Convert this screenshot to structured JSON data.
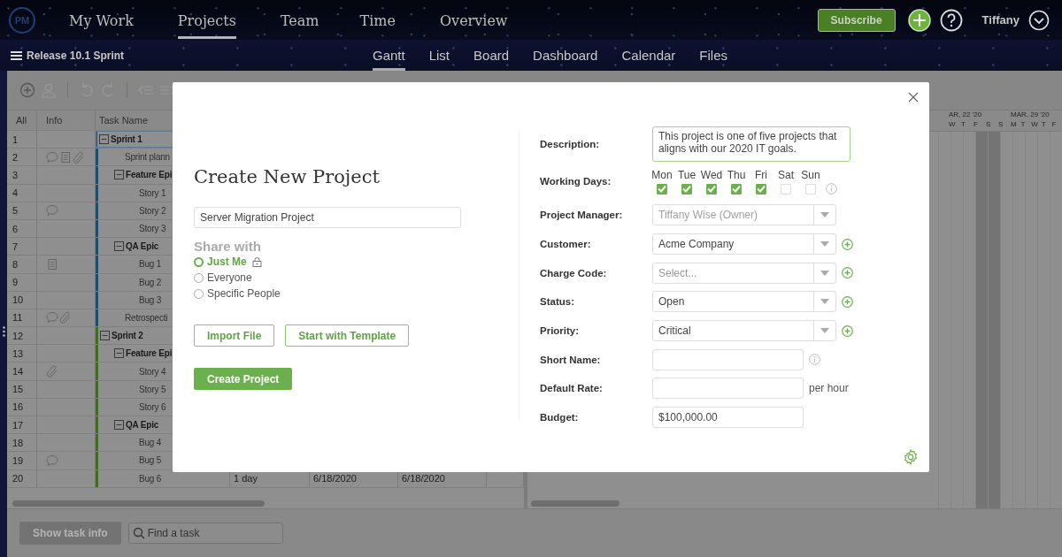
{
  "top_nav": {
    "logo": "PM",
    "items": [
      {
        "label": "My Work",
        "selected": false
      },
      {
        "label": "Projects",
        "selected": true
      },
      {
        "label": "Team",
        "selected": false
      },
      {
        "label": "Time",
        "selected": false
      },
      {
        "label": "Overview",
        "selected": false
      }
    ],
    "subscribe": "Subscribe",
    "user": "Tiffany"
  },
  "sub_nav": {
    "project": "Release 10.1 Sprint",
    "views": [
      {
        "label": "Gantt",
        "selected": true
      },
      {
        "label": "List",
        "selected": false
      },
      {
        "label": "Board",
        "selected": false
      },
      {
        "label": "Dashboard",
        "selected": false
      },
      {
        "label": "Calendar",
        "selected": false
      },
      {
        "label": "Files",
        "selected": false
      }
    ]
  },
  "grid": {
    "columns": [
      "All",
      "Info",
      "Task Name"
    ],
    "tasks": [
      {
        "number": "1",
        "name": "Sprint 1",
        "kind": "group",
        "expanded": true,
        "selected": true,
        "color": "#1f4f70",
        "children": [
          {
            "number": "2",
            "name": "Sprint plann",
            "kind": "task",
            "selected": false,
            "comment": true,
            "note": true,
            "attachment": true
          },
          {
            "number": "3",
            "name": "Feature Epi",
            "kind": "group",
            "expanded": true,
            "selected": false,
            "children": [
              {
                "number": "4",
                "name": "Story 1",
                "kind": "task",
                "selected": false
              },
              {
                "number": "5",
                "name": "Story 2",
                "kind": "task",
                "selected": false,
                "comment": true
              },
              {
                "number": "6",
                "name": "Story 3",
                "kind": "task",
                "selected": false
              }
            ]
          },
          {
            "number": "7",
            "name": "QA Epic",
            "kind": "group",
            "expanded": true,
            "selected": false,
            "children": [
              {
                "number": "8",
                "name": "Bug 1",
                "kind": "task",
                "selected": false,
                "note": true
              },
              {
                "number": "9",
                "name": "Bug 2",
                "kind": "task",
                "selected": false
              },
              {
                "number": "10",
                "name": "Bug 3",
                "kind": "task",
                "selected": false
              }
            ]
          },
          {
            "number": "11",
            "name": "Retrospecti",
            "kind": "task",
            "selected": false,
            "comment": true,
            "attachment": true
          }
        ]
      },
      {
        "number": "12",
        "name": "Sprint 2",
        "kind": "group",
        "expanded": true,
        "selected": false,
        "color": "#3f6b22",
        "children": [
          {
            "number": "13",
            "name": "Feature Epi",
            "kind": "group",
            "expanded": true,
            "selected": false,
            "children": [
              {
                "number": "14",
                "name": "Story 4",
                "kind": "task",
                "selected": false,
                "attachment": true
              },
              {
                "number": "15",
                "name": "Story 5",
                "kind": "task",
                "selected": false
              },
              {
                "number": "16",
                "name": "Story 6",
                "kind": "task",
                "selected": false
              }
            ]
          },
          {
            "number": "17",
            "name": "QA Epic",
            "kind": "group",
            "expanded": true,
            "selected": false,
            "children": [
              {
                "number": "18",
                "name": "Bug 4",
                "kind": "task",
                "selected": false
              },
              {
                "number": "19",
                "name": "Bug 5",
                "kind": "task",
                "selected": false,
                "comment": true
              },
              {
                "number": "20",
                "name": "Bug 6",
                "kind": "task",
                "selected": false,
                "duration": "1 day",
                "start": "6/18/2020",
                "finish": "6/18/2020"
              }
            ]
          }
        ]
      }
    ]
  },
  "gantt": {
    "weeks": [
      {
        "label": "AR, 22 '20",
        "days": [
          {
            "label": "W",
            "weekend": false
          },
          {
            "label": "T",
            "weekend": false
          },
          {
            "label": "F",
            "weekend": false
          },
          {
            "label": "S",
            "weekend": true
          },
          {
            "label": "S",
            "weekend": true
          }
        ]
      },
      {
        "label": "MAR, 29 '20",
        "days": [
          {
            "label": "M",
            "weekend": false
          },
          {
            "label": "T",
            "weekend": false
          },
          {
            "label": "W",
            "weekend": false
          },
          {
            "label": "T",
            "weekend": false
          },
          {
            "label": "F",
            "weekend": false
          }
        ]
      }
    ]
  },
  "bottom_bar": {
    "show_task_info": "Show task info",
    "search": {
      "placeholder": "Find a task"
    }
  },
  "dialog": {
    "title": "Create New Project",
    "name_field": {
      "value": "Server Migration Project"
    },
    "share": {
      "label": "Share with",
      "options": [
        {
          "label": "Just Me",
          "selected": true,
          "locked": true
        },
        {
          "label": "Everyone",
          "selected": false,
          "locked": false
        },
        {
          "label": "Specific People",
          "selected": false,
          "locked": false
        }
      ]
    },
    "import_button": "Import File",
    "template_button": "Start with Template",
    "create_button": "Create Project",
    "fields": [
      {
        "kind": "textarea",
        "label": "Description:",
        "value": "This project is one of five projects that aligns with our 2020 IT goals."
      },
      {
        "kind": "days",
        "label": "Working Days:",
        "info": true,
        "days": [
          {
            "label": "Mon",
            "checked": true
          },
          {
            "label": "Tue",
            "checked": true
          },
          {
            "label": "Wed",
            "checked": true
          },
          {
            "label": "Thu",
            "checked": true
          },
          {
            "label": "Fri",
            "checked": true
          },
          {
            "label": "Sat",
            "checked": false
          },
          {
            "label": "Sun",
            "checked": false
          }
        ]
      },
      {
        "kind": "select",
        "label": "Project Manager:",
        "value": "Tiffany Wise (Owner)",
        "disabled": true,
        "add": false
      },
      {
        "kind": "select",
        "label": "Customer:",
        "value": "Acme Company",
        "disabled": false,
        "add": true
      },
      {
        "kind": "select",
        "label": "Charge Code:",
        "placeholder": "Select...",
        "disabled": false,
        "add": true
      },
      {
        "kind": "select",
        "label": "Status:",
        "value": "Open",
        "disabled": false,
        "add": true
      },
      {
        "kind": "select",
        "label": "Priority:",
        "value": "Critical",
        "disabled": false,
        "add": true
      },
      {
        "kind": "text",
        "label": "Short Name:",
        "info": true
      },
      {
        "kind": "text",
        "label": "Default Rate:",
        "suffix": "per hour",
        "info": false
      },
      {
        "kind": "text",
        "label": "Budget:",
        "value": "$100,000.00",
        "info": false
      }
    ]
  }
}
